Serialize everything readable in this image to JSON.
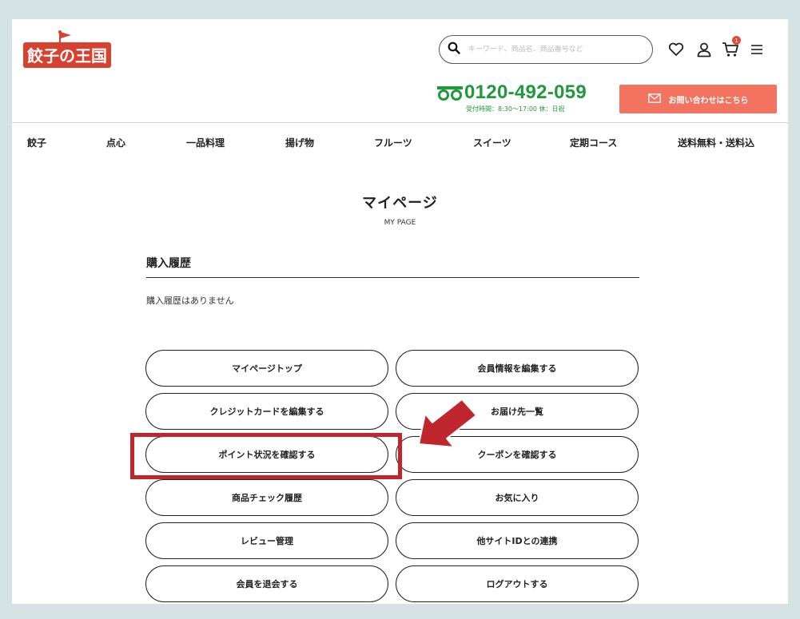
{
  "header": {
    "logo_text": "餃子の王国",
    "search_placeholder": "キーワード、商品名、商品番号など",
    "cart_count": "1",
    "phone_number": "0120-492-059",
    "phone_hours": "受付時間：8:30〜17:00 休：日祝",
    "contact_label": "お問い合わせはこちら"
  },
  "nav": [
    "餃子",
    "点心",
    "一品料理",
    "揚げ物",
    "フルーツ",
    "スイーツ",
    "定期コース",
    "送料無料・送料込"
  ],
  "page": {
    "title": "マイページ",
    "subtitle": "MY PAGE",
    "section_heading": "購入履歴",
    "empty_history": "購入履歴はありません"
  },
  "buttons": {
    "left": [
      "マイページトップ",
      "クレジットカードを編集する",
      "ポイント状況を確認する",
      "商品チェック履歴",
      "レビュー管理",
      "会員を退会する"
    ],
    "right": [
      "会員情報を編集する",
      "お届け先一覧",
      "クーポンを確認する",
      "お気に入り",
      "他サイトIDとの連携",
      "ログアウトする"
    ]
  },
  "colors": {
    "background": "#d5e3e5",
    "brand_red": "#d8402f",
    "phone_green": "#1f9a3a",
    "contact_button": "#f2735f",
    "annotation_red": "#c0262d"
  },
  "icons": [
    "search-icon",
    "heart-icon",
    "user-icon",
    "cart-icon",
    "menu-icon",
    "mail-icon",
    "freedial-icon"
  ]
}
